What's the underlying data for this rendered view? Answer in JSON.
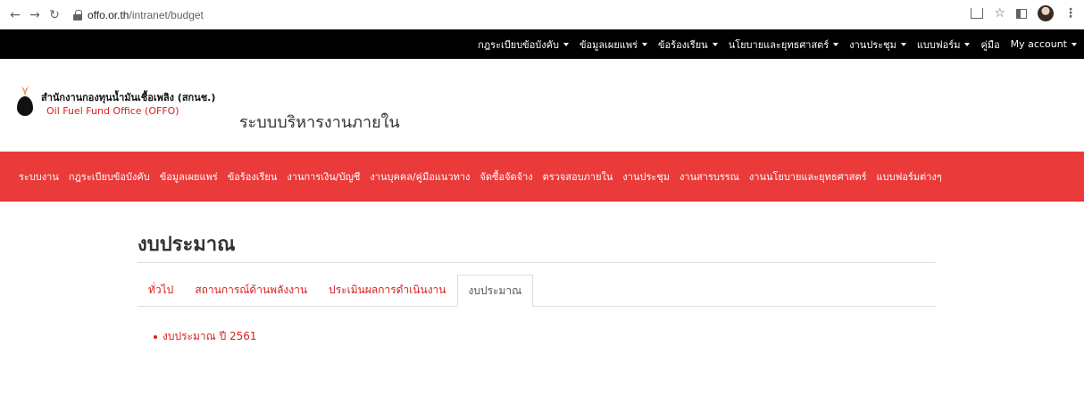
{
  "browser": {
    "url_host": "offo.or.th",
    "url_path": "/intranet/budget"
  },
  "top_menu": {
    "items": [
      {
        "label": "กฎระเบียบข้อบังคับ",
        "dropdown": true
      },
      {
        "label": "ข้อมูลเผยแพร่",
        "dropdown": true
      },
      {
        "label": "ข้อร้องเรียน",
        "dropdown": true
      },
      {
        "label": "นโยบายและยุทธศาสตร์",
        "dropdown": true
      },
      {
        "label": "งานประชุม",
        "dropdown": true
      },
      {
        "label": "แบบฟอร์ม",
        "dropdown": true
      },
      {
        "label": "คู่มือ",
        "dropdown": false
      },
      {
        "label": "My account",
        "dropdown": true
      }
    ]
  },
  "header": {
    "org_name_th": "สำนักงานกองทุนน้ำมันเชื้อเพลิง (สกนช.)",
    "org_name_en": "Oil Fuel Fund Office (OFFO)",
    "system_name": "ระบบบริหารงานภายใน"
  },
  "main_menu": {
    "items": [
      "ระบบงาน",
      "กฎระเบียบข้อบังคับ",
      "ข้อมูลเผยแพร่",
      "ข้อร้องเรียน",
      "งานการเงิน/บัญชี",
      "งานบุคคล/คู่มือแนวทาง",
      "จัดซื้อจัดจ้าง",
      "ตรวจสอบภายใน",
      "งานประชุม",
      "งานสารบรรณ",
      "งานนโยบายและยุทธศาสตร์",
      "แบบฟอร์มต่างๆ"
    ]
  },
  "page": {
    "title": "งบประมาณ",
    "tabs": [
      {
        "label": "ทั่วไป",
        "active": false
      },
      {
        "label": "สถานการณ์ด้านพลังงาน",
        "active": false
      },
      {
        "label": "ประเมินผลการดำเนินงาน",
        "active": false
      },
      {
        "label": "งบประมาณ",
        "active": true
      }
    ],
    "links": [
      "งบประมาณ ปี 2561"
    ]
  },
  "colors": {
    "brand_red": "#ea3a3a",
    "link_red": "#d81f1f",
    "top_menu_bg": "#000000"
  }
}
